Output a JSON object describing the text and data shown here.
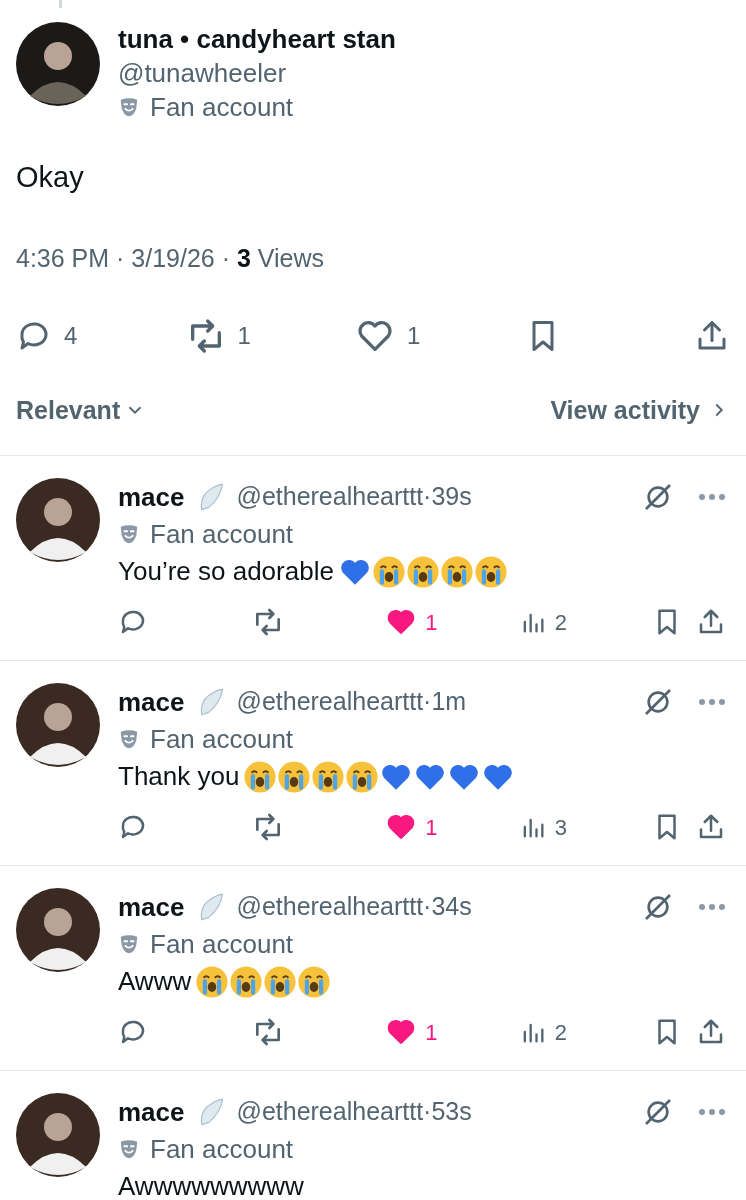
{
  "post": {
    "display_name": "tuna • candyheart stan",
    "handle": "@tunawheeler",
    "label": "Fan account",
    "text": "Okay",
    "meta": "4:36 PM · 3/19/26 · **3** Views",
    "actions": {
      "replies": "4",
      "reposts": "1",
      "likes": "1",
      "liked": false
    }
  },
  "sort": {
    "label": "Relevant",
    "activity": "View activity"
  },
  "replies": [
    {
      "name": "mace",
      "handle": "@etherealhearttt·39s",
      "label": "Fan account",
      "text": "You’re so adorable",
      "emoji": [
        {
          "kind": "blue_heart"
        },
        {
          "kind": "sob"
        },
        {
          "kind": "sob"
        },
        {
          "kind": "sob"
        },
        {
          "kind": "sob"
        }
      ],
      "likes": "1",
      "liked": true,
      "views": "2"
    },
    {
      "name": "mace",
      "handle": "@etherealhearttt·1m",
      "label": "Fan account",
      "text": "Thank you",
      "emoji": [
        {
          "kind": "sob"
        },
        {
          "kind": "sob"
        },
        {
          "kind": "sob"
        },
        {
          "kind": "sob"
        },
        {
          "kind": "blue_heart"
        },
        {
          "kind": "blue_heart"
        },
        {
          "kind": "blue_heart"
        },
        {
          "kind": "blue_heart"
        }
      ],
      "likes": "1",
      "liked": true,
      "views": "3"
    },
    {
      "name": "mace",
      "handle": "@etherealhearttt·34s",
      "label": "Fan account",
      "text": "Awww",
      "emoji": [
        {
          "kind": "sob"
        },
        {
          "kind": "sob"
        },
        {
          "kind": "sob"
        },
        {
          "kind": "sob"
        }
      ],
      "likes": "1",
      "liked": true,
      "views": "2"
    },
    {
      "name": "mace",
      "handle": "@etherealhearttt·53s",
      "label": "Fan account",
      "text": "Awwwwwwwww"
    }
  ]
}
